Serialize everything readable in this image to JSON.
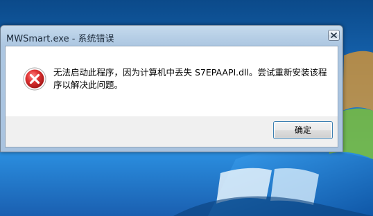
{
  "dialog": {
    "title": "MWSmart.exe - 系统错误",
    "message": "无法启动此程序，因为计算机中丢失 S7EPAAPI.dll。尝试重新安装该程序以解决此问题。",
    "ok_label": "确定",
    "icon": "error-icon"
  },
  "colors": {
    "error_red": "#d32a2a",
    "dialog_frame": "#b7cfe6",
    "desktop_blue": "#1b6fc0"
  }
}
